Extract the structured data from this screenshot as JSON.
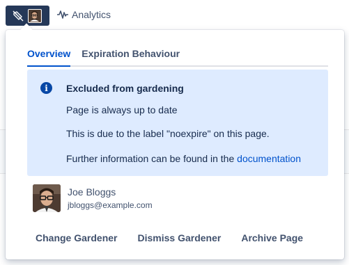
{
  "toolbar": {
    "gardener_icon": "tag-slash-icon",
    "analytics_icon": "pulse-line-icon",
    "analytics_label": "Analytics"
  },
  "popup": {
    "tabs": [
      {
        "label": "Overview",
        "active": true
      },
      {
        "label": "Expiration Behaviour",
        "active": false
      }
    ],
    "info": {
      "icon": "info-icon",
      "icon_glyph": "i",
      "title": "Excluded from gardening",
      "line1": "Page is always up to date",
      "line2": "This is due to the label \"noexpire\" on this page.",
      "line3_prefix": "Further information can be found in the ",
      "line3_link": "documentation"
    },
    "user": {
      "name": "Joe Bloggs",
      "email": "jbloggs@example.com"
    },
    "actions": {
      "change": "Change Gardener",
      "dismiss": "Dismiss Gardener",
      "archive": "Archive Page"
    }
  },
  "colors": {
    "trigger_bg": "#253858",
    "accent": "#0052cc",
    "info_bg": "#deebff",
    "info_icon": "#0747a6",
    "text": "#172b4d",
    "subtle_text": "#42526e"
  }
}
